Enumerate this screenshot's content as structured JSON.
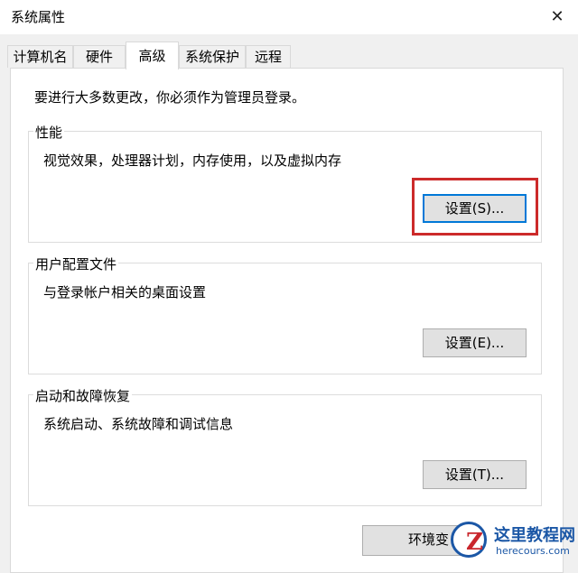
{
  "window": {
    "title": "系统属性",
    "close_glyph": "✕"
  },
  "tabs": [
    {
      "label": "计算机名"
    },
    {
      "label": "硬件"
    },
    {
      "label": "高级"
    },
    {
      "label": "系统保护"
    },
    {
      "label": "远程"
    }
  ],
  "admin_note": "要进行大多数更改，你必须作为管理员登录。",
  "performance": {
    "title": "性能",
    "desc": "视觉效果，处理器计划，内存使用，以及虚拟内存",
    "button": "设置(S)..."
  },
  "user_profiles": {
    "title": "用户配置文件",
    "desc": "与登录帐户相关的桌面设置",
    "button": "设置(E)..."
  },
  "startup_recovery": {
    "title": "启动和故障恢复",
    "desc": "系统启动、系统故障和调试信息",
    "button": "设置(T)..."
  },
  "env_button": "环境变",
  "watermark": {
    "logo_letter": "Z",
    "title": "这里教程网",
    "url": "herecours.com"
  },
  "colors": {
    "highlight": "#cc2a2a",
    "focus": "#0078d7",
    "brand": "#1b57a6"
  }
}
